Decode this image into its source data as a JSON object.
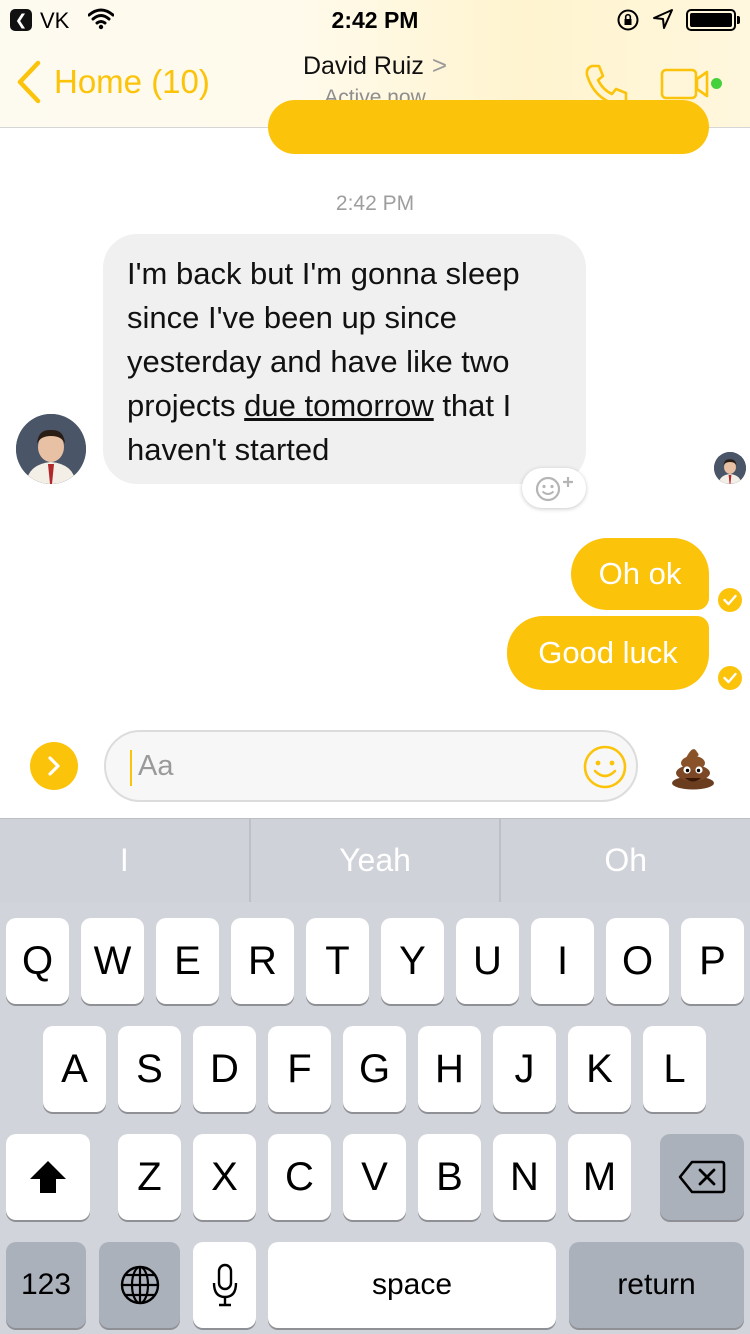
{
  "status_bar": {
    "carrier": "VK",
    "time": "2:42 PM"
  },
  "nav": {
    "back_label": "Home (10)",
    "title": "David Ruiz",
    "title_chevron": ">",
    "subtitle": "Active now"
  },
  "messages": {
    "timestamp": "2:42 PM",
    "incoming_1": {
      "part_a": "I'm back but I'm gonna sleep since I've been up since yesterday and have like two projects ",
      "underlined": "due tomorrow",
      "part_b": " that I haven't started"
    },
    "outgoing_1": "Oh ok",
    "outgoing_2": "Good luck"
  },
  "composer": {
    "placeholder": "Aa"
  },
  "keyboard": {
    "suggestions": [
      "I",
      "Yeah",
      "Oh"
    ],
    "row1": [
      "Q",
      "W",
      "E",
      "R",
      "T",
      "Y",
      "U",
      "I",
      "O",
      "P"
    ],
    "row2": [
      "A",
      "S",
      "D",
      "F",
      "G",
      "H",
      "J",
      "K",
      "L"
    ],
    "row3": [
      "Z",
      "X",
      "C",
      "V",
      "B",
      "N",
      "M"
    ],
    "numbers_label": "123",
    "space_label": "space",
    "return_label": "return"
  },
  "colors": {
    "accent": "#fcc30b",
    "incoming_bubble": "#f0f0f0",
    "online_dot": "#44d13c",
    "keyboard_bg": "#d1d4da"
  },
  "icons": {
    "status_back": "back-to-app-icon",
    "wifi": "wifi-icon",
    "orientation_lock": "orientation-lock-icon",
    "location": "location-arrow-icon",
    "battery": "battery-icon",
    "phone": "phone-icon",
    "video": "video-camera-icon",
    "react": "add-reaction-icon",
    "read_receipt": "seen-check-icon",
    "more": "chevron-right-icon",
    "emoji": "smiley-icon",
    "quick_reaction": "poop-emoji-icon",
    "shift": "shift-arrow-icon",
    "delete": "backspace-icon",
    "globe": "globe-icon",
    "mic": "microphone-icon"
  }
}
